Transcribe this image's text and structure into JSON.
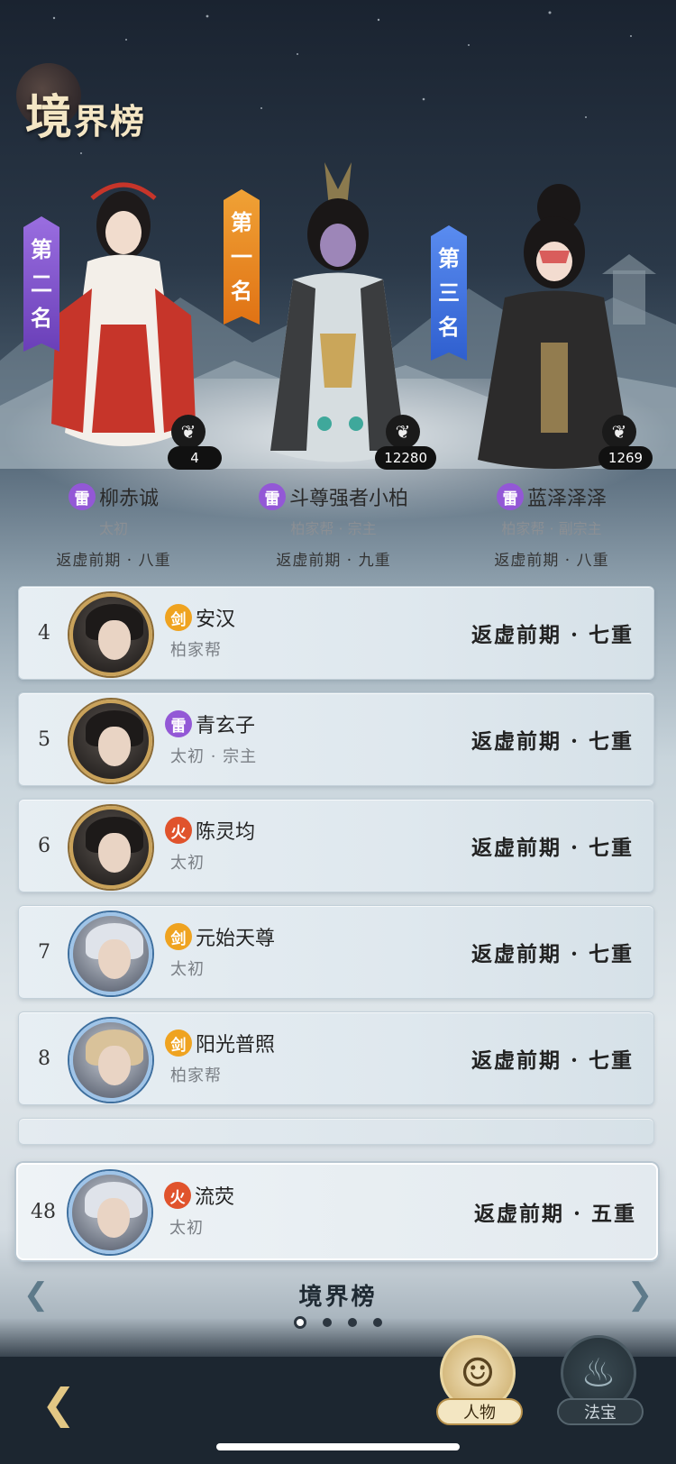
{
  "header": {
    "title_big": "境",
    "title_small": "界榜"
  },
  "podium": [
    {
      "slot": "p2",
      "banner": [
        "第",
        "二",
        "名"
      ],
      "banner_color": "purple",
      "score": "4"
    },
    {
      "slot": "p1",
      "banner": [
        "第",
        "一",
        "名"
      ],
      "banner_color": "orange",
      "score": "12280"
    },
    {
      "slot": "p3",
      "banner": [
        "第",
        "三",
        "名"
      ],
      "banner_color": "blue",
      "score": "1269"
    }
  ],
  "top3": [
    {
      "element": "雷",
      "name": "柳赤诚",
      "guild": "太初",
      "realm": "返虚前期 · 八重"
    },
    {
      "element": "雷",
      "name": "斗尊强者小柏",
      "guild": "柏家帮 · 宗主",
      "realm": "返虚前期 · 九重"
    },
    {
      "element": "雷",
      "name": "蓝泽泽泽",
      "guild": "柏家帮 · 副宗主",
      "realm": "返虚前期 · 八重"
    }
  ],
  "rows": [
    {
      "rank": "4",
      "element": "剑",
      "name": "安汉",
      "guild": "柏家帮",
      "realm": "返虚前期 · 七重"
    },
    {
      "rank": "5",
      "element": "雷",
      "name": "青玄子",
      "guild": "太初 · 宗主",
      "realm": "返虚前期 · 七重"
    },
    {
      "rank": "6",
      "element": "火",
      "name": "陈灵均",
      "guild": "太初",
      "realm": "返虚前期 · 七重"
    },
    {
      "rank": "7",
      "element": "剑",
      "name": "元始天尊",
      "guild": "太初",
      "realm": "返虚前期 · 七重"
    },
    {
      "rank": "8",
      "element": "剑",
      "name": "阳光普照",
      "guild": "柏家帮",
      "realm": "返虚前期 · 七重"
    }
  ],
  "self": {
    "rank": "48",
    "element": "火",
    "name": "流荧",
    "guild": "太初",
    "realm": "返虚前期 · 五重"
  },
  "page_nav": {
    "title": "境界榜",
    "page_count": 4,
    "active_page": 0
  },
  "bottom": {
    "tab_people": "人物",
    "tab_treasure": "法宝"
  },
  "colors": {
    "lei": "#9358d6",
    "jian": "#efa320",
    "huo": "#e0532c"
  }
}
